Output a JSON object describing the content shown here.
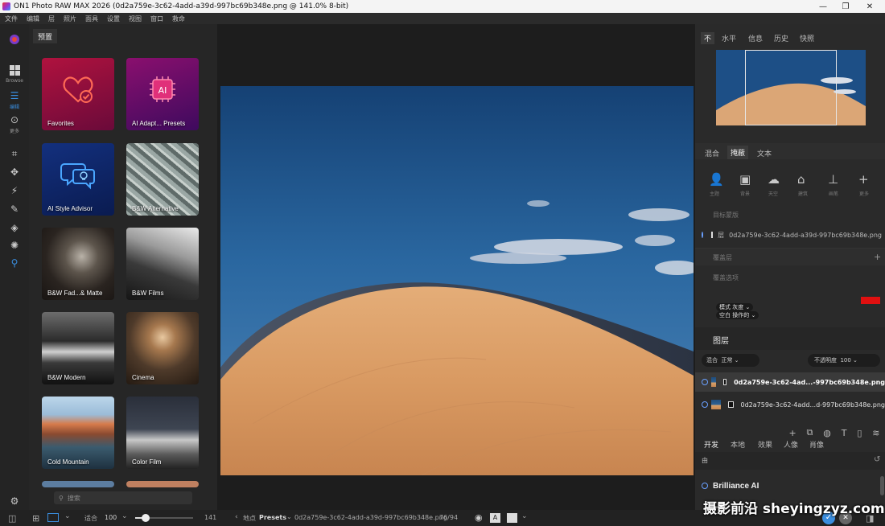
{
  "window": {
    "title": "ON1 Photo RAW MAX 2026 (0d2a759e-3c62-4add-a39d-997bc69b348e.png @ 141.0% 8-bit)"
  },
  "menu": [
    "文件",
    "编辑",
    "层",
    "照片",
    "面具",
    "设置",
    "视图",
    "窗口",
    "救命"
  ],
  "toolrail": {
    "browse_label": "Browse",
    "edit_label": "编辑",
    "more_label": "更多"
  },
  "browser": {
    "tab": "预置",
    "presets": [
      {
        "label": "Favorites"
      },
      {
        "label": "AI Adapt... Presets"
      },
      {
        "label": "AI Style Advisor"
      },
      {
        "label": "B&W Alternative"
      },
      {
        "label": "B&W Fad...& Matte"
      },
      {
        "label": "B&W Films"
      },
      {
        "label": "B&W Modern"
      },
      {
        "label": "Cinema"
      },
      {
        "label": "Cold Mountain"
      },
      {
        "label": "Color Film"
      }
    ],
    "search_placeholder": "搜索"
  },
  "right": {
    "top_tabs": [
      "不",
      "水平",
      "信息",
      "历史",
      "快照"
    ],
    "mid_tabs": [
      "混合",
      "掩蔽",
      "文本"
    ],
    "mask_tools": [
      "主题",
      "背景",
      "天空",
      "建筑",
      "画笔",
      "更多"
    ],
    "target_label": "目标蒙版",
    "mask_layer_name": "0d2a759e-3c62-4add-a39d-997bc69b348e.png",
    "mask_layer_prefix": "层",
    "overlay_label": "覆盖层",
    "overlay_options": "覆盖选项",
    "mode_label": "模式",
    "mode_value": "灰度",
    "view_label": "空白",
    "view_value": "操作的",
    "layers_title": "图层",
    "blend_label": "混合",
    "blend_value": "正常",
    "opacity_label": "不透明度",
    "opacity_value": "100",
    "layers": [
      {
        "name": "0d2a759e-3c62-4ad...-997bc69b348e.png"
      },
      {
        "name": "0d2a759e-3c62-4add...d-997bc69b348e.png"
      }
    ],
    "dev_tabs": [
      "开发",
      "本地",
      "效果",
      "人像",
      "肖像"
    ],
    "brilliance": "Brilliance AI",
    "sub_label": "由"
  },
  "status": {
    "fit_label": "适合",
    "zoom": "100",
    "zoom_max": "141",
    "breadcrumb_prefix": "地点",
    "breadcrumb_folder": "Presets",
    "breadcrumb_file": "0d2a759e-3c62-4add-a39d-997bc69b348e.png",
    "count": "76/94"
  },
  "watermark": "摄影前沿 sheyingzyz.com",
  "colors": {
    "accent": "#3a8dde",
    "swatch": "#e01010"
  }
}
